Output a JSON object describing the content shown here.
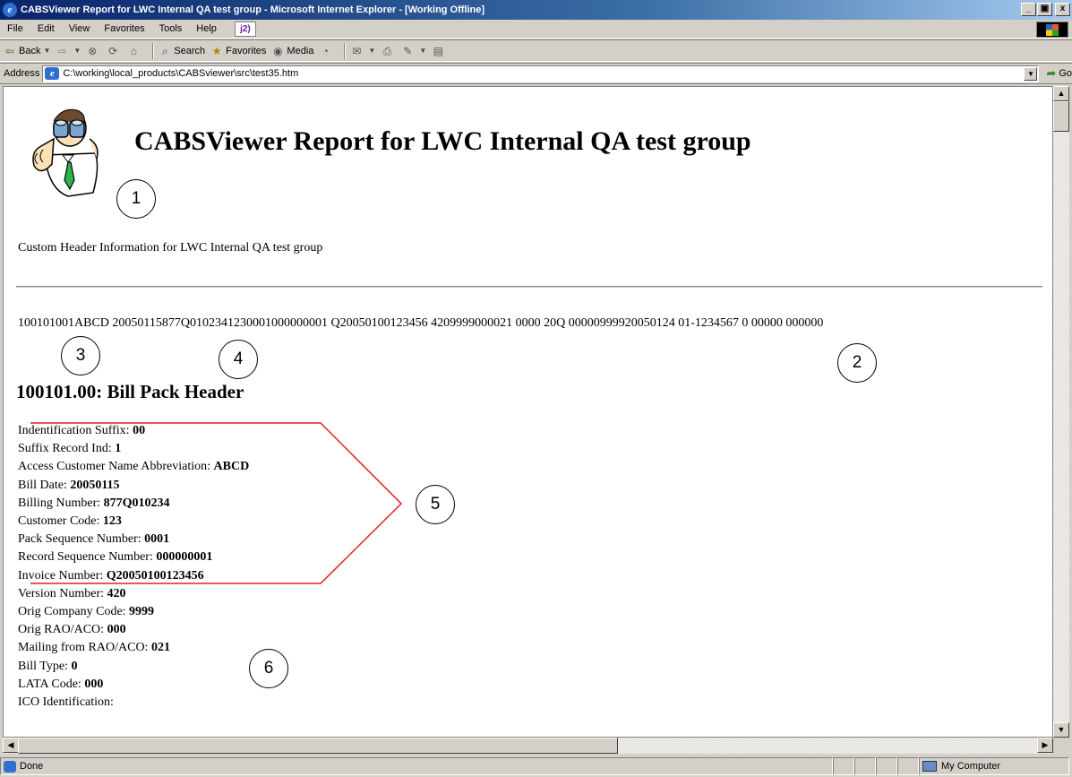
{
  "window": {
    "title": "CABSViewer Report for LWC Internal QA test group - Microsoft Internet Explorer - [Working Offline]",
    "buttons": [
      "_",
      "̈",
      "x"
    ]
  },
  "menu": {
    "items": [
      "File",
      "Edit",
      "View",
      "Favorites",
      "Tools",
      "Help"
    ],
    "plugin_label": "j2)"
  },
  "toolbar": {
    "back": "Back",
    "search": "Search",
    "favorites": "Favorites",
    "media": "Media"
  },
  "address": {
    "label": "Address",
    "value": "C:\\working\\local_products\\CABSviewer\\src\\test35.htm",
    "go": "Go"
  },
  "page": {
    "heading": "CABSViewer Report for LWC Internal QA test group",
    "custom_header": "Custom Header Information for LWC Internal QA test group",
    "raw_record": "100101001ABCD 20050115877Q0102341230001000000001 Q20050100123456 4209999000021 0000 20Q 00000999920050124 01-1234567 0 00000 000000",
    "section_title": "100101.00: Bill Pack Header",
    "fields": [
      {
        "label": "Indentification Suffix: ",
        "value": "00"
      },
      {
        "label": "Suffix Record Ind: ",
        "value": "1"
      },
      {
        "label": "Access Customer Name Abbreviation: ",
        "value": "ABCD"
      },
      {
        "label": "Bill Date: ",
        "value": "20050115"
      },
      {
        "label": "Billing Number: ",
        "value": "877Q010234"
      },
      {
        "label": "Customer Code: ",
        "value": "123"
      },
      {
        "label": "Pack Sequence Number: ",
        "value": "0001"
      },
      {
        "label": "Record Sequence Number: ",
        "value": "000000001"
      },
      {
        "label": "Invoice Number: ",
        "value": "Q20050100123456"
      },
      {
        "label": "Version Number: ",
        "value": "420"
      },
      {
        "label": "Orig Company Code: ",
        "value": "9999"
      },
      {
        "label": "Orig RAO/ACO: ",
        "value": "000"
      },
      {
        "label": "Mailing from RAO/ACO: ",
        "value": "021"
      },
      {
        "label": "Bill Type: ",
        "value": "0"
      },
      {
        "label": "LATA Code: ",
        "value": "000"
      },
      {
        "label": "ICO Identification:",
        "value": ""
      }
    ],
    "callouts": [
      "1",
      "2",
      "3",
      "4",
      "5",
      "6"
    ],
    "bracket_color": "#e02020"
  },
  "status": {
    "left": "Done",
    "zone": "My Computer"
  },
  "icons": {
    "logo": "binoculars-man-icon",
    "ie": "ie-icon",
    "back": "back-arrow-icon",
    "forward": "forward-arrow-icon",
    "stop": "stop-icon",
    "refresh": "refresh-icon",
    "home": "home-icon",
    "search": "search-icon",
    "favorites": "favorites-icon",
    "media": "media-icon",
    "history": "history-icon",
    "mail": "mail-icon",
    "print": "print-icon",
    "edit": "edit-icon",
    "discuss": "discuss-icon"
  }
}
